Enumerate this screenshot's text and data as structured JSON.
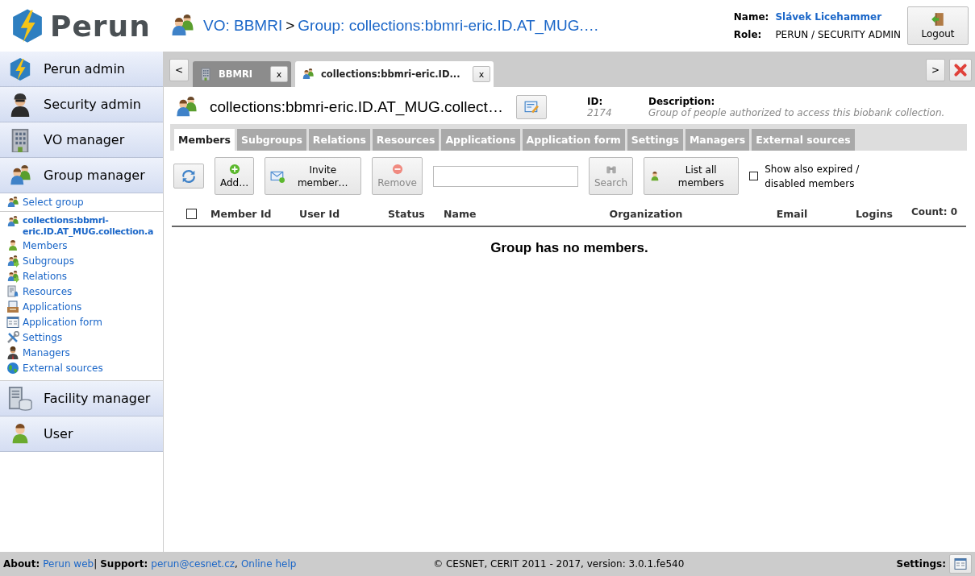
{
  "header": {
    "logo_text": "Perun",
    "breadcrumb": [
      {
        "kind": "link",
        "text": "VO: BBMRI"
      },
      {
        "kind": "separator",
        "text": ">"
      },
      {
        "kind": "link",
        "text": "Group: collections:bbmri-eric.ID.AT_MUG.…"
      }
    ],
    "user": {
      "name_label": "Name:",
      "name": "Slávek Licehammer",
      "role_label": "Role:",
      "role": "PERUN / SECURITY ADMIN"
    },
    "logout": "Logout"
  },
  "sidebar": {
    "sections": [
      {
        "label": "Perun admin"
      },
      {
        "label": "Security admin"
      },
      {
        "label": "VO manager"
      },
      {
        "label": "Group manager",
        "select_label": "Select group",
        "group_label": "collections:bbmri-eric.ID.AT_MUG.collection.a",
        "items": [
          "Members",
          "Subgroups",
          "Relations",
          "Resources",
          "Applications",
          "Application form",
          "Settings",
          "Managers",
          "External sources"
        ]
      },
      {
        "label": "Facility manager"
      },
      {
        "label": "User"
      }
    ]
  },
  "tabbar": {
    "prev": "<",
    "next": ">",
    "tabs": [
      {
        "label": "BBMRI",
        "close": "x",
        "selected": false
      },
      {
        "label": "collections:bbmri-eric.ID...",
        "close": "x",
        "selected": true
      }
    ]
  },
  "group": {
    "title": "collections:bbmri-eric.ID.AT_MUG.collect…",
    "id_label": "ID:",
    "id": "2174",
    "description_label": "Description:",
    "description": "Group of people authorized to access this biobank collection."
  },
  "subtabs": [
    {
      "label": "Members",
      "selected": true
    },
    {
      "label": "Subgroups",
      "selected": false
    },
    {
      "label": "Relations",
      "selected": false
    },
    {
      "label": "Resources",
      "selected": false
    },
    {
      "label": "Applications",
      "selected": false
    },
    {
      "label": "Application form",
      "selected": false
    },
    {
      "label": "Settings",
      "selected": false
    },
    {
      "label": "Managers",
      "selected": false
    },
    {
      "label": "External sources",
      "selected": false
    }
  ],
  "toolbar": {
    "add": {
      "label": "Add…",
      "disabled": false
    },
    "invite": {
      "label": "Invite member…",
      "disabled": false
    },
    "remove": {
      "label": "Remove",
      "disabled": true
    },
    "search": {
      "label": "Search",
      "disabled": true
    },
    "list_all": {
      "label": "List all members",
      "disabled": false
    },
    "show_expired": {
      "label": "Show also expired / disabled members",
      "checked": false
    }
  },
  "table": {
    "select_all": {
      "checked": false
    },
    "columns": [
      "Member Id",
      "User Id",
      "Status",
      "Name",
      "Organization",
      "Email",
      "Logins"
    ],
    "count": "Count: 0",
    "empty_message": "Group has no members."
  },
  "footer": {
    "left": [
      {
        "kind": "label",
        "text": "About:"
      },
      {
        "kind": "link",
        "text": "Perun web"
      },
      {
        "kind": "text",
        "text": "|"
      },
      {
        "kind": "label",
        "text": "Support:"
      },
      {
        "kind": "link",
        "text": "perun@cesnet.cz"
      },
      {
        "kind": "text",
        "text": ","
      },
      {
        "kind": "link",
        "text": "Online help"
      }
    ],
    "copyright": "© CESNET, CERIT 2011 - 2017, version: 3.0.1.fe540",
    "settings_label": "Settings:"
  }
}
